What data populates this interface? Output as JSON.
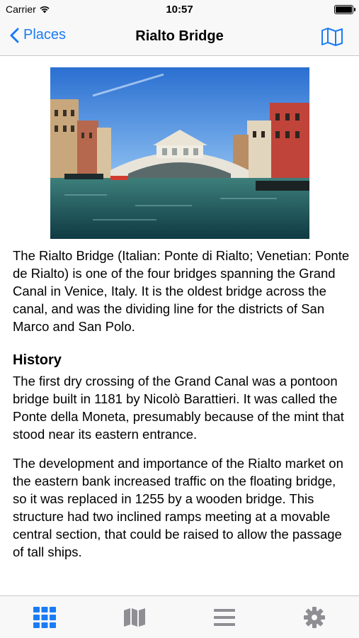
{
  "status_bar": {
    "carrier": "Carrier",
    "time": "10:57"
  },
  "nav": {
    "back_label": "Places",
    "title": "Rialto Bridge",
    "map_icon": "map-icon"
  },
  "article": {
    "intro": "The Rialto Bridge (Italian: Ponte di Rialto; Venetian: Ponte de Rialto) is one of the four bridges spanning the Grand Canal in Venice, Italy. It is the oldest bridge across the canal, and was the dividing line for the districts of San Marco and San Polo.",
    "history_heading": "History",
    "history_p1": "The first dry crossing of the Grand Canal was a pontoon bridge built in 1181 by Nicolò Barattieri. It was called the Ponte della Moneta, presumably because of the mint that stood near its eastern entrance.",
    "history_p2": "The development and importance of the Rialto market on the eastern bank increased traffic on the floating bridge, so it was replaced in 1255 by a wooden bridge. This structure had two inclined ramps meeting at a movable central section, that could be raised to allow the passage of tall ships."
  },
  "tab_bar": {
    "tabs": [
      {
        "icon": "grid-icon",
        "active": true
      },
      {
        "icon": "map-icon",
        "active": false
      },
      {
        "icon": "list-icon",
        "active": false
      },
      {
        "icon": "gear-icon",
        "active": false
      }
    ]
  },
  "colors": {
    "accent": "#1a7cf5",
    "inactive": "#8e8e93",
    "bar_bg": "#f8f8f8"
  }
}
